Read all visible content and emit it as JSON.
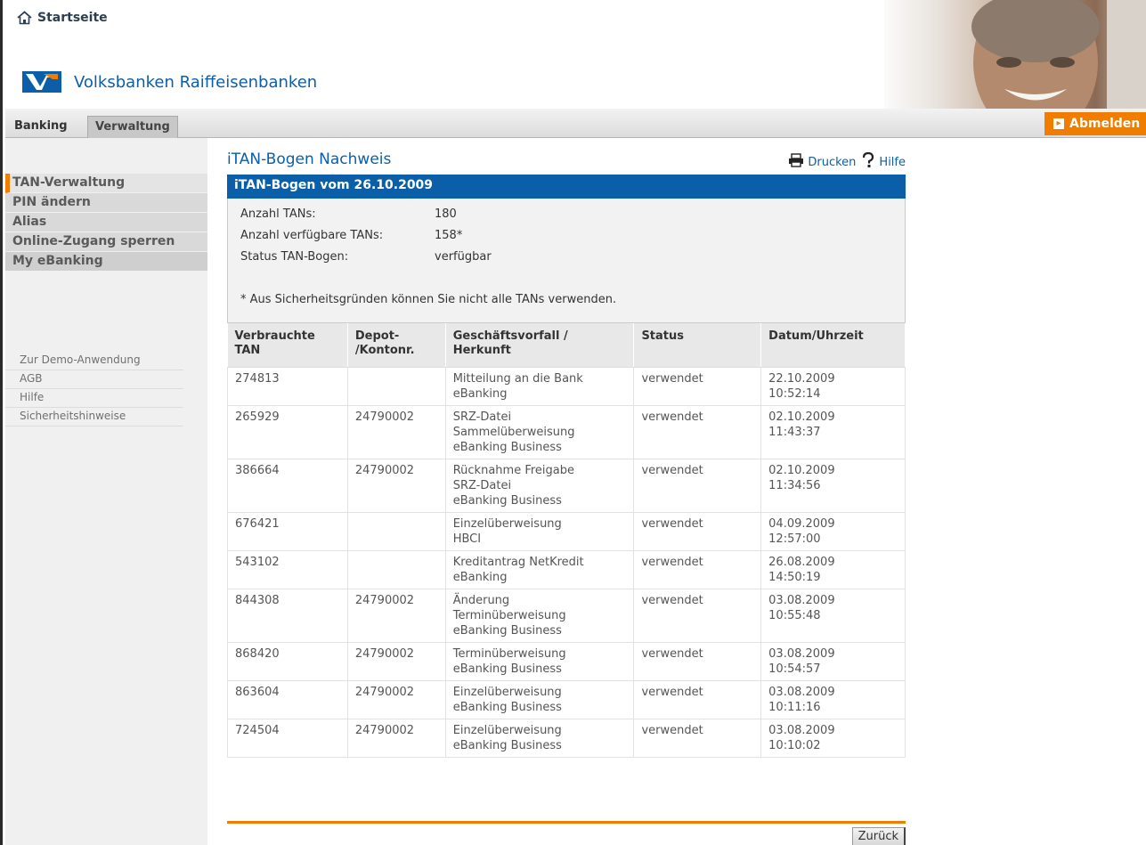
{
  "header": {
    "home_label": "Startseite",
    "bank_name": "Volksbanken Raiffeisenbanken"
  },
  "nav": {
    "tabs": [
      {
        "label": "Banking"
      },
      {
        "label": "Verwaltung",
        "active": true
      }
    ],
    "logout_label": "Abmelden"
  },
  "sidebar": {
    "menu": [
      {
        "label": "TAN-Verwaltung",
        "active": true
      },
      {
        "label": "PIN ändern"
      },
      {
        "label": "Alias"
      },
      {
        "label": "Online-Zugang sperren"
      },
      {
        "label": "My eBanking"
      }
    ],
    "links": [
      {
        "label": "Zur Demo-Anwendung"
      },
      {
        "label": "AGB"
      },
      {
        "label": "Hilfe"
      },
      {
        "label": "Sicherheitshinweise"
      }
    ]
  },
  "main": {
    "title": "iTAN-Bogen Nachweis",
    "print_label": "Drucken",
    "help_label": "Hilfe",
    "box_title": "iTAN-Bogen vom 26.10.2009",
    "info": [
      {
        "label": "Anzahl TANs:",
        "value": "180"
      },
      {
        "label": "Anzahl verfügbare TANs:",
        "value": "158*"
      },
      {
        "label": "Status TAN-Bogen:",
        "value": "verfügbar"
      }
    ],
    "note": "* Aus Sicherheitsgründen können Sie nicht alle TANs verwenden.",
    "table": {
      "headers": [
        [
          "Verbrauchte",
          "TAN"
        ],
        [
          "Depot-",
          "/Kontonr."
        ],
        [
          "Geschäftsvorfall /",
          "Herkunft"
        ],
        [
          "Status"
        ],
        [
          "Datum/Uhrzeit"
        ]
      ],
      "rows": [
        {
          "tan": "274813",
          "konto": "",
          "vorfall": [
            "Mitteilung an die Bank",
            "eBanking"
          ],
          "status": "verwendet",
          "datum": [
            "22.10.2009",
            "10:52:14"
          ]
        },
        {
          "tan": "265929",
          "konto": "24790002",
          "vorfall": [
            "SRZ-Datei",
            "Sammelüberweisung",
            "eBanking Business"
          ],
          "status": "verwendet",
          "datum": [
            "02.10.2009",
            "11:43:37"
          ]
        },
        {
          "tan": "386664",
          "konto": "24790002",
          "vorfall": [
            "Rücknahme Freigabe",
            "SRZ-Datei",
            "eBanking Business"
          ],
          "status": "verwendet",
          "datum": [
            "02.10.2009",
            "11:34:56"
          ]
        },
        {
          "tan": "676421",
          "konto": "",
          "vorfall": [
            "Einzelüberweisung",
            "HBCI"
          ],
          "status": "verwendet",
          "datum": [
            "04.09.2009",
            "12:57:00"
          ]
        },
        {
          "tan": "543102",
          "konto": "",
          "vorfall": [
            "Kreditantrag NetKredit",
            "eBanking"
          ],
          "status": "verwendet",
          "datum": [
            "26.08.2009",
            "14:50:19"
          ]
        },
        {
          "tan": "844308",
          "konto": "24790002",
          "vorfall": [
            "Änderung",
            "Terminüberweisung",
            "eBanking Business"
          ],
          "status": "verwendet",
          "datum": [
            "03.08.2009",
            "10:55:48"
          ]
        },
        {
          "tan": "868420",
          "konto": "24790002",
          "vorfall": [
            "Terminüberweisung",
            "eBanking Business"
          ],
          "status": "verwendet",
          "datum": [
            "03.08.2009",
            "10:54:57"
          ]
        },
        {
          "tan": "863604",
          "konto": "24790002",
          "vorfall": [
            "Einzelüberweisung",
            "eBanking Business"
          ],
          "status": "verwendet",
          "datum": [
            "03.08.2009",
            "10:11:16"
          ]
        },
        {
          "tan": "724504",
          "konto": "24790002",
          "vorfall": [
            "Einzelüberweisung",
            "eBanking Business"
          ],
          "status": "verwendet",
          "datum": [
            "03.08.2009",
            "10:10:02"
          ]
        }
      ]
    },
    "back_label": "Zurück"
  },
  "colors": {
    "brand_blue": "#0b5fa8",
    "accent_orange": "#f07c00"
  }
}
